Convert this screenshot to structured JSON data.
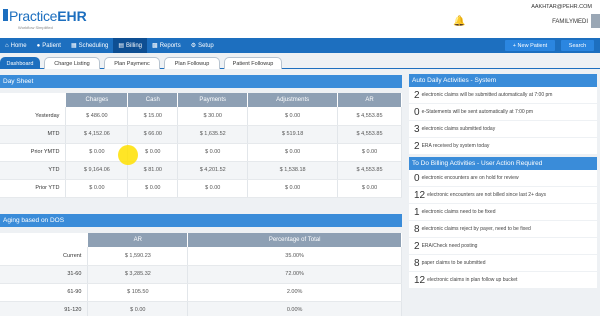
{
  "brand": {
    "name_part1": "Practice",
    "name_part2": "EHR",
    "tagline": "Workflow Simplified"
  },
  "user": {
    "email": "AAKHTAR@PEHR.COM",
    "name": "FAMILYMEDI"
  },
  "nav": [
    {
      "label": "Home",
      "icon": "home-icon"
    },
    {
      "label": "Patient",
      "icon": "user-icon"
    },
    {
      "label": "Scheduling",
      "icon": "calendar-icon"
    },
    {
      "label": "Billing",
      "icon": "billing-icon"
    },
    {
      "label": "Reports",
      "icon": "chart-icon"
    },
    {
      "label": "Setup",
      "icon": "gear-icon"
    }
  ],
  "actions": {
    "new_patient": "+ New Patient",
    "search": "Search"
  },
  "tabs": [
    "Dashboard",
    "Charge Listing",
    "Plan Paymenc",
    "Plan Followup",
    "Patient Followup"
  ],
  "day_sheet": {
    "title": "Day Sheet",
    "columns": [
      "Charges",
      "Cash",
      "Payments",
      "Adjustments",
      "AR"
    ],
    "rows": [
      {
        "label": "Yesterday",
        "values": [
          "$ 486.00",
          "$ 15.00",
          "$ 30.00",
          "$ 0.00",
          "$ 4,553.85"
        ]
      },
      {
        "label": "MTD",
        "values": [
          "$ 4,152.06",
          "$ 66.00",
          "$ 1,635.52",
          "$ 519.18",
          "$ 4,553.85"
        ]
      },
      {
        "label": "Prior YMTD",
        "values": [
          "$ 0.00",
          "$ 0.00",
          "$ 0.00",
          "$ 0.00",
          "$ 0.00"
        ]
      },
      {
        "label": "YTD",
        "values": [
          "$ 9,164.06",
          "$ 81.00",
          "$ 4,201.52",
          "$ 1,538.18",
          "$ 4,553.85"
        ]
      },
      {
        "label": "Prior YTD",
        "values": [
          "$ 0.00",
          "$ 0.00",
          "$ 0.00",
          "$ 0.00",
          "$ 0.00"
        ]
      }
    ]
  },
  "aging": {
    "title": "Aging based on DOS",
    "columns": [
      "AR",
      "Percentage of Total"
    ],
    "rows": [
      {
        "label": "Current",
        "values": [
          "$ 1,590.23",
          "35.00%"
        ]
      },
      {
        "label": "31-60",
        "values": [
          "$ 3,285.32",
          "72.00%"
        ]
      },
      {
        "label": "61-90",
        "values": [
          "$ 105.50",
          "2.00%"
        ]
      },
      {
        "label": "91-120",
        "values": [
          "$ 0.00",
          "0.00%"
        ]
      }
    ]
  },
  "auto_billing": {
    "title": "Auto Daily Activities - System",
    "items": [
      {
        "count": "2",
        "text": "electronic claims will be submitted automatically at 7:00 pm"
      },
      {
        "count": "0",
        "text": "e-Statements will be sent automatically at 7:00 pm"
      },
      {
        "count": "3",
        "text": "electronic claims submitted today"
      },
      {
        "count": "2",
        "text": "ERA received by system today"
      }
    ]
  },
  "todo_billing": {
    "title": "To Do Billing Activities - User Action Required",
    "items": [
      {
        "count": "0",
        "text": "electronic encounters are on hold for review"
      },
      {
        "count": "12",
        "text": "electronic encounters are not billed since last 2+ days"
      },
      {
        "count": "1",
        "text": "electronic claims need to be fixed"
      },
      {
        "count": "8",
        "text": "electronic claims reject by payer, need to be fixed"
      },
      {
        "count": "2",
        "text": "ERA/Check need posting"
      },
      {
        "count": "8",
        "text": "paper claims to be submitted"
      },
      {
        "count": "12",
        "text": "electronic claims in plan follow up bucket"
      }
    ]
  }
}
